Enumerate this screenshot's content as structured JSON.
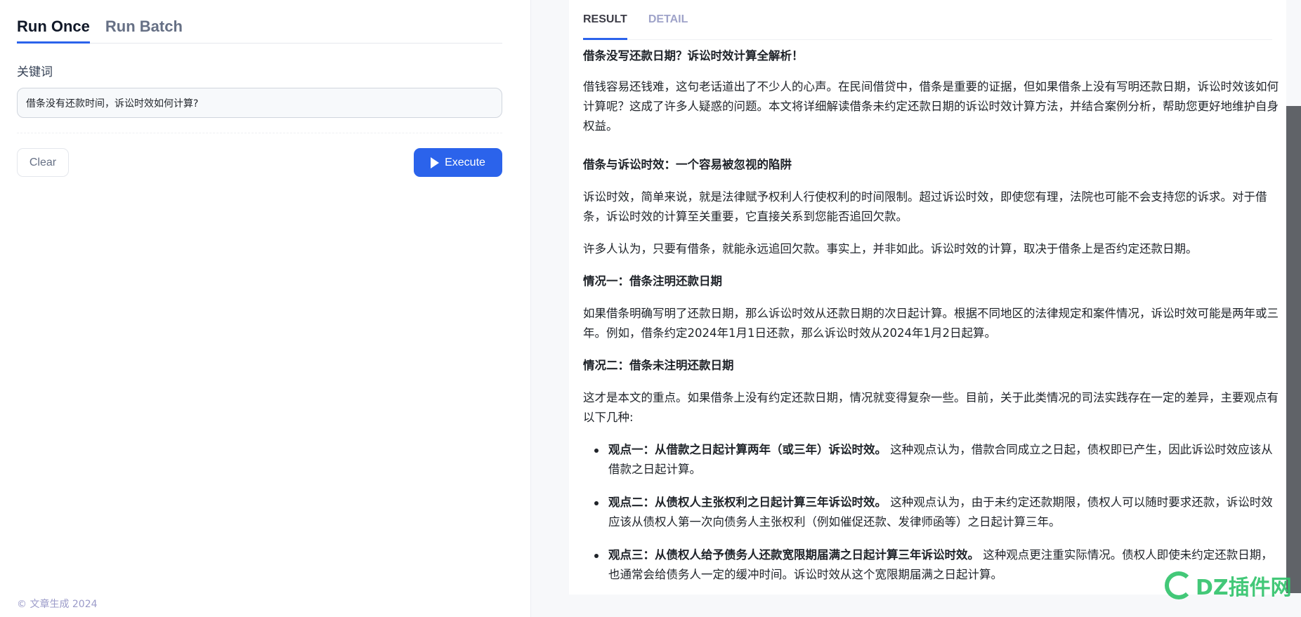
{
  "left": {
    "tabs": [
      {
        "label": "Run Once",
        "active": true
      },
      {
        "label": "Run Batch",
        "active": false
      }
    ],
    "keyword_label": "关键词",
    "keyword_value": "借条没有还款时间，诉讼时效如何计算?",
    "clear_label": "Clear",
    "execute_label": "Execute",
    "footer": "© 文章生成 2024"
  },
  "result": {
    "tabs": [
      {
        "label": "RESULT",
        "active": true
      },
      {
        "label": "DETAIL",
        "active": false
      }
    ],
    "title": "借条没写还款日期？诉讼时效计算全解析！",
    "intro": "借钱容易还钱难，这句老话道出了不少人的心声。在民间借贷中，借条是重要的证据，但如果借条上没有写明还款日期，诉讼时效该如何计算呢？这成了许多人疑惑的问题。本文将详细解读借条未约定还款日期的诉讼时效计算方法，并结合案例分析，帮助您更好地维护自身权益。",
    "section1": "借条与诉讼时效：一个容易被忽视的陷阱",
    "p1": "诉讼时效，简单来说，就是法律赋予权利人行使权利的时间限制。超过诉讼时效，即使您有理，法院也可能不会支持您的诉求。对于借条，诉讼时效的计算至关重要，它直接关系到您能否追回欠款。",
    "p2": "许多人认为，只要有借条，就能永远追回欠款。事实上，并非如此。诉讼时效的计算，取决于借条上是否约定还款日期。",
    "case1": "情况一：借条注明还款日期",
    "p3": "如果借条明确写明了还款日期，那么诉讼时效从还款日期的次日起计算。根据不同地区的法律规定和案件情况，诉讼时效可能是两年或三年。例如，借条约定2024年1月1日还款，那么诉讼时效从2024年1月2日起算。",
    "case2": "情况二：借条未注明还款日期",
    "p4": "这才是本文的重点。如果借条上没有约定还款日期，情况就变得复杂一些。目前，关于此类情况的司法实践存在一定的差异，主要观点有以下几种:",
    "views": [
      {
        "lead": "观点一：从借款之日起计算两年（或三年）诉讼时效。",
        "text": "这种观点认为，借款合同成立之日起，债权即已产生，因此诉讼时效应该从借款之日起计算。"
      },
      {
        "lead": "观点二：从债权人主张权利之日起计算三年诉讼时效。",
        "text": "这种观点认为，由于未约定还款期限，债权人可以随时要求还款，诉讼时效应该从债权人第一次向债务人主张权利（例如催促还款、发律师函等）之日起计算三年。"
      },
      {
        "lead": "观点三：从债权人给予债务人还款宽限期届满之日起计算三年诉讼时效。",
        "text": "这种观点更注重实际情况。债权人即使未约定还款日期，也通常会给债务人一定的缓冲时间。诉讼时效从这个宽限期届满之日起计算。"
      }
    ]
  },
  "watermark": "DZ插件网",
  "colors": {
    "accent": "#2b63eb",
    "scroll_thumb": "#606368"
  }
}
